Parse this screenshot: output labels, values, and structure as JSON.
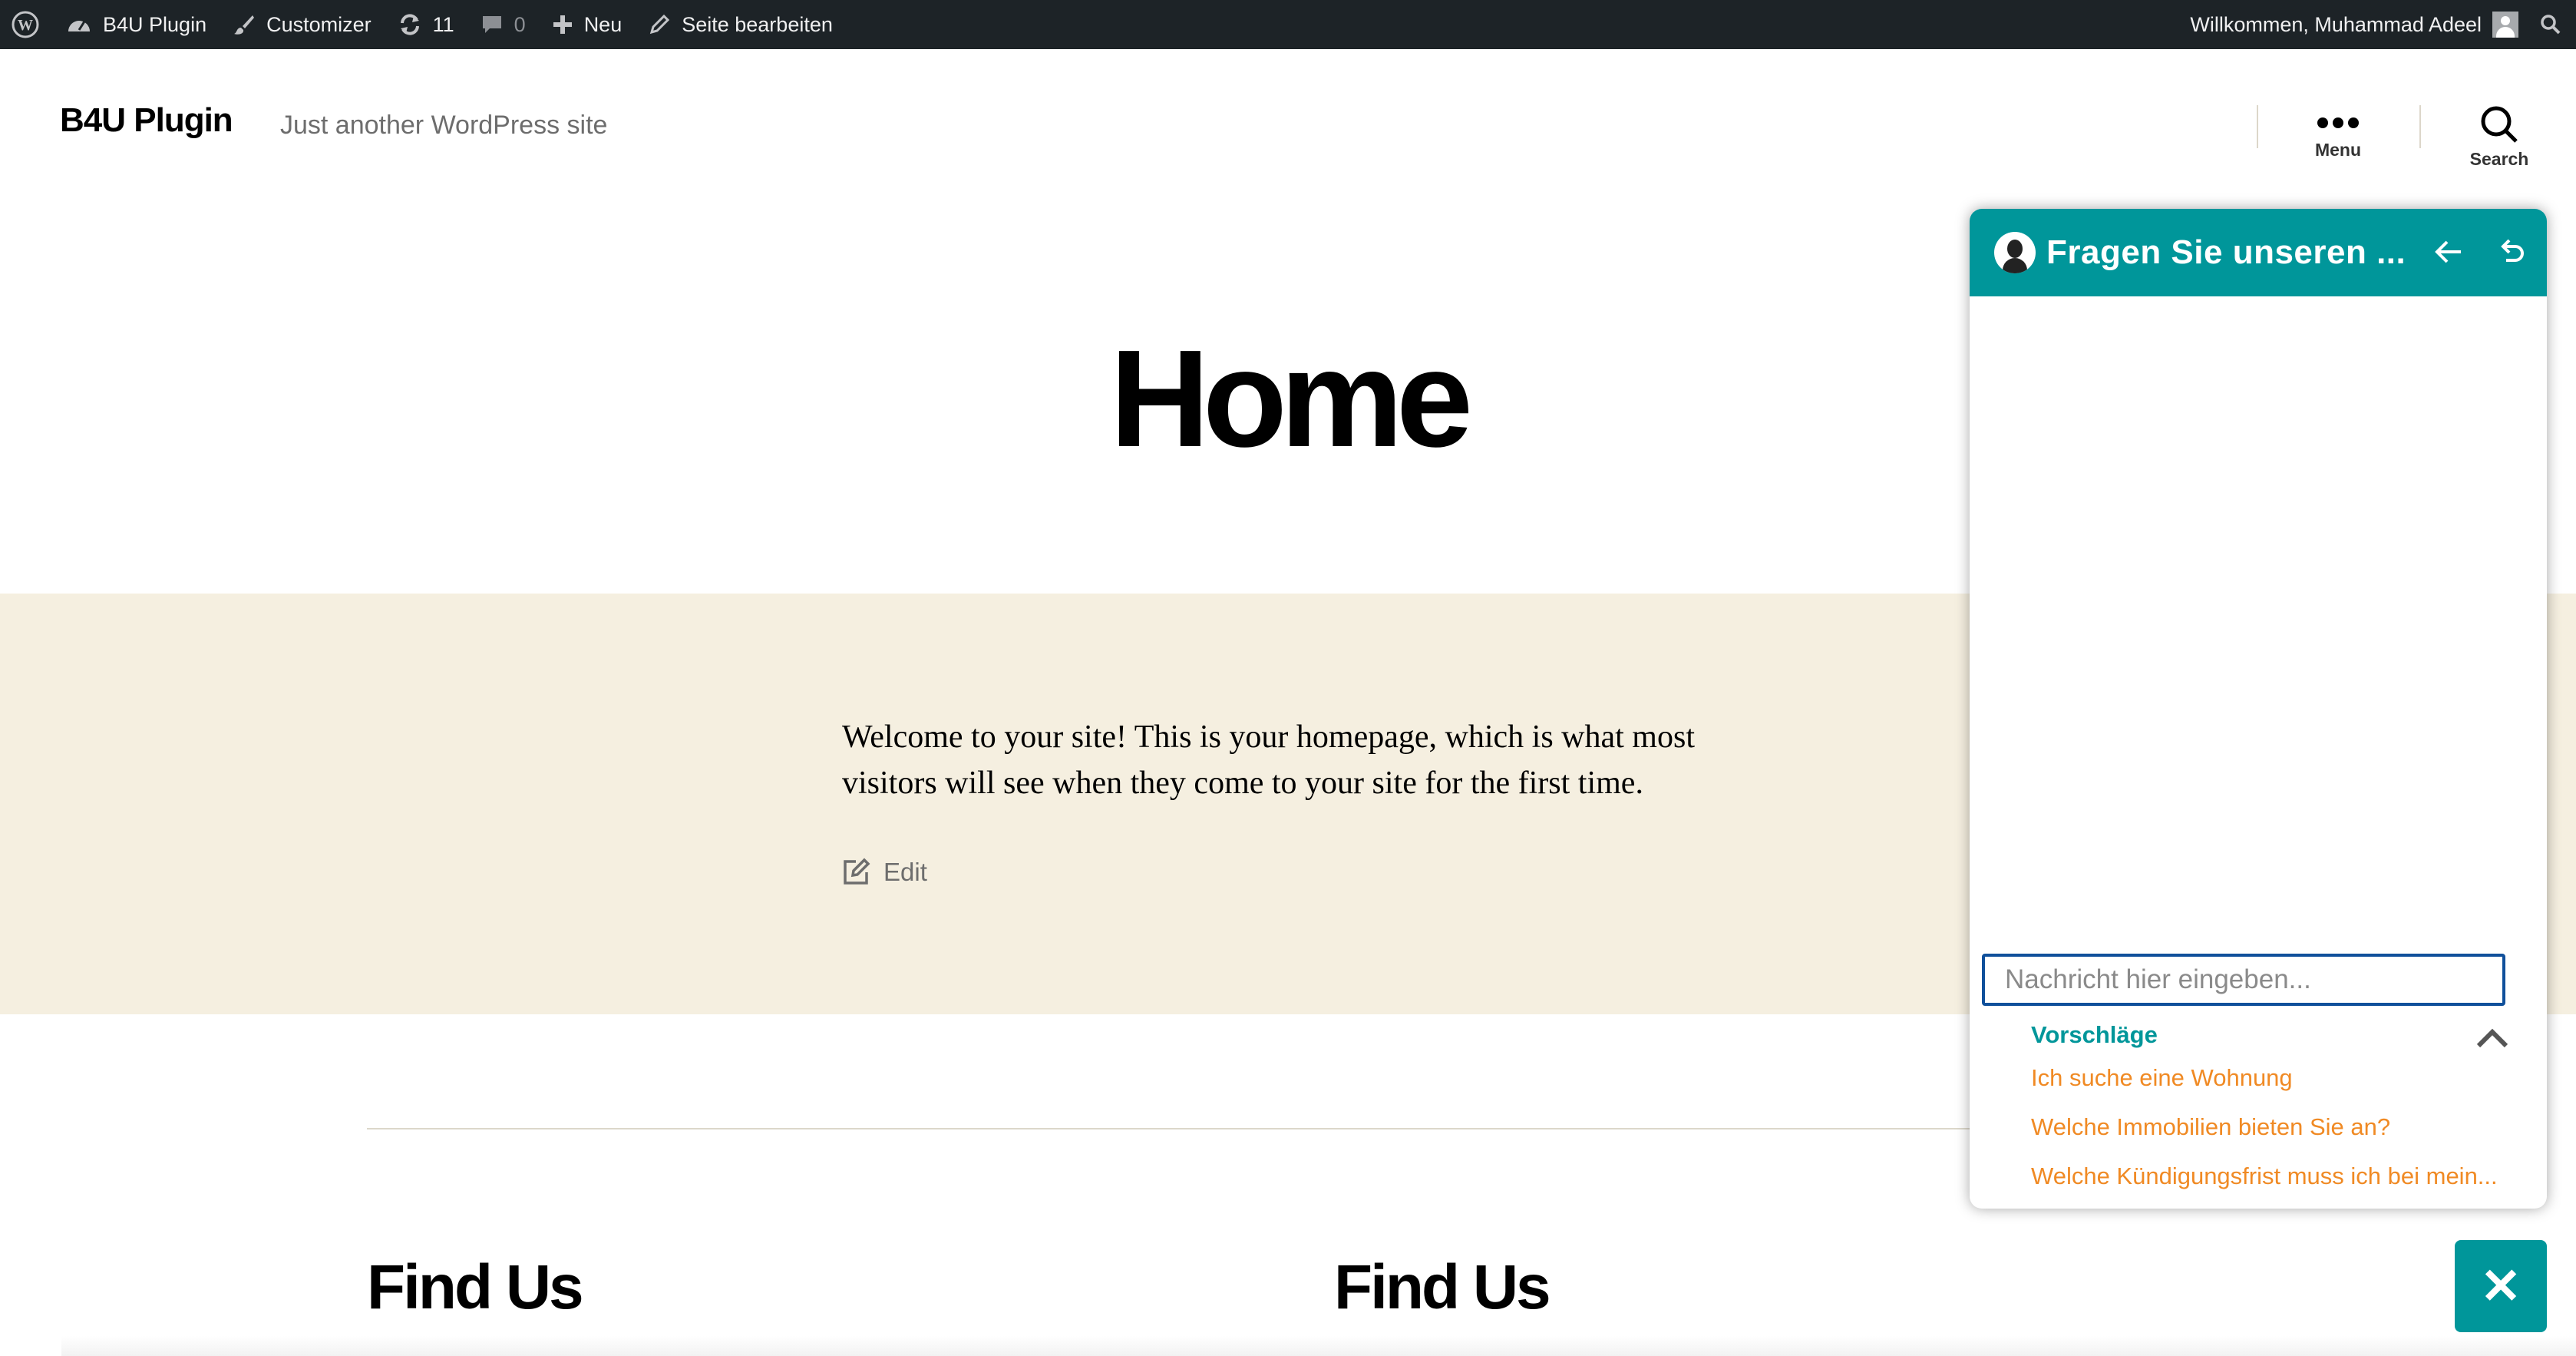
{
  "admin_bar": {
    "site_name": "B4U Plugin",
    "customizer": "Customizer",
    "updates_count": "11",
    "comments_count": "0",
    "new_label": "Neu",
    "edit_page": "Seite bearbeiten",
    "greeting": "Willkommen, Muhammad Adeel"
  },
  "header": {
    "site_title": "B4U Plugin",
    "tagline": "Just another WordPress site",
    "menu_label": "Menu",
    "search_label": "Search"
  },
  "page": {
    "title": "Home",
    "welcome_line1": "Welcome to your site! This is your homepage, which is what most",
    "welcome_line2": "visitors will see when they come to your site for the first time.",
    "edit_label": "Edit",
    "find_us_left": "Find Us",
    "find_us_right": "Find Us"
  },
  "chat": {
    "title": "Fragen Sie unseren ...",
    "input_placeholder": "Nachricht hier eingeben...",
    "suggestions_heading": "Vorschläge",
    "suggestions": [
      "Ich suche eine Wohnung",
      "Welche Immobilien bieten Sie an?",
      "Welche Kündigungsfrist muss ich bei mein..."
    ],
    "close_glyph": "✕"
  },
  "colors": {
    "admin_bar": "#1d2327",
    "beige_section": "#f5efe0",
    "chat_accent": "#00969a",
    "suggestion_text": "#f08a24",
    "input_border": "#10509b"
  }
}
